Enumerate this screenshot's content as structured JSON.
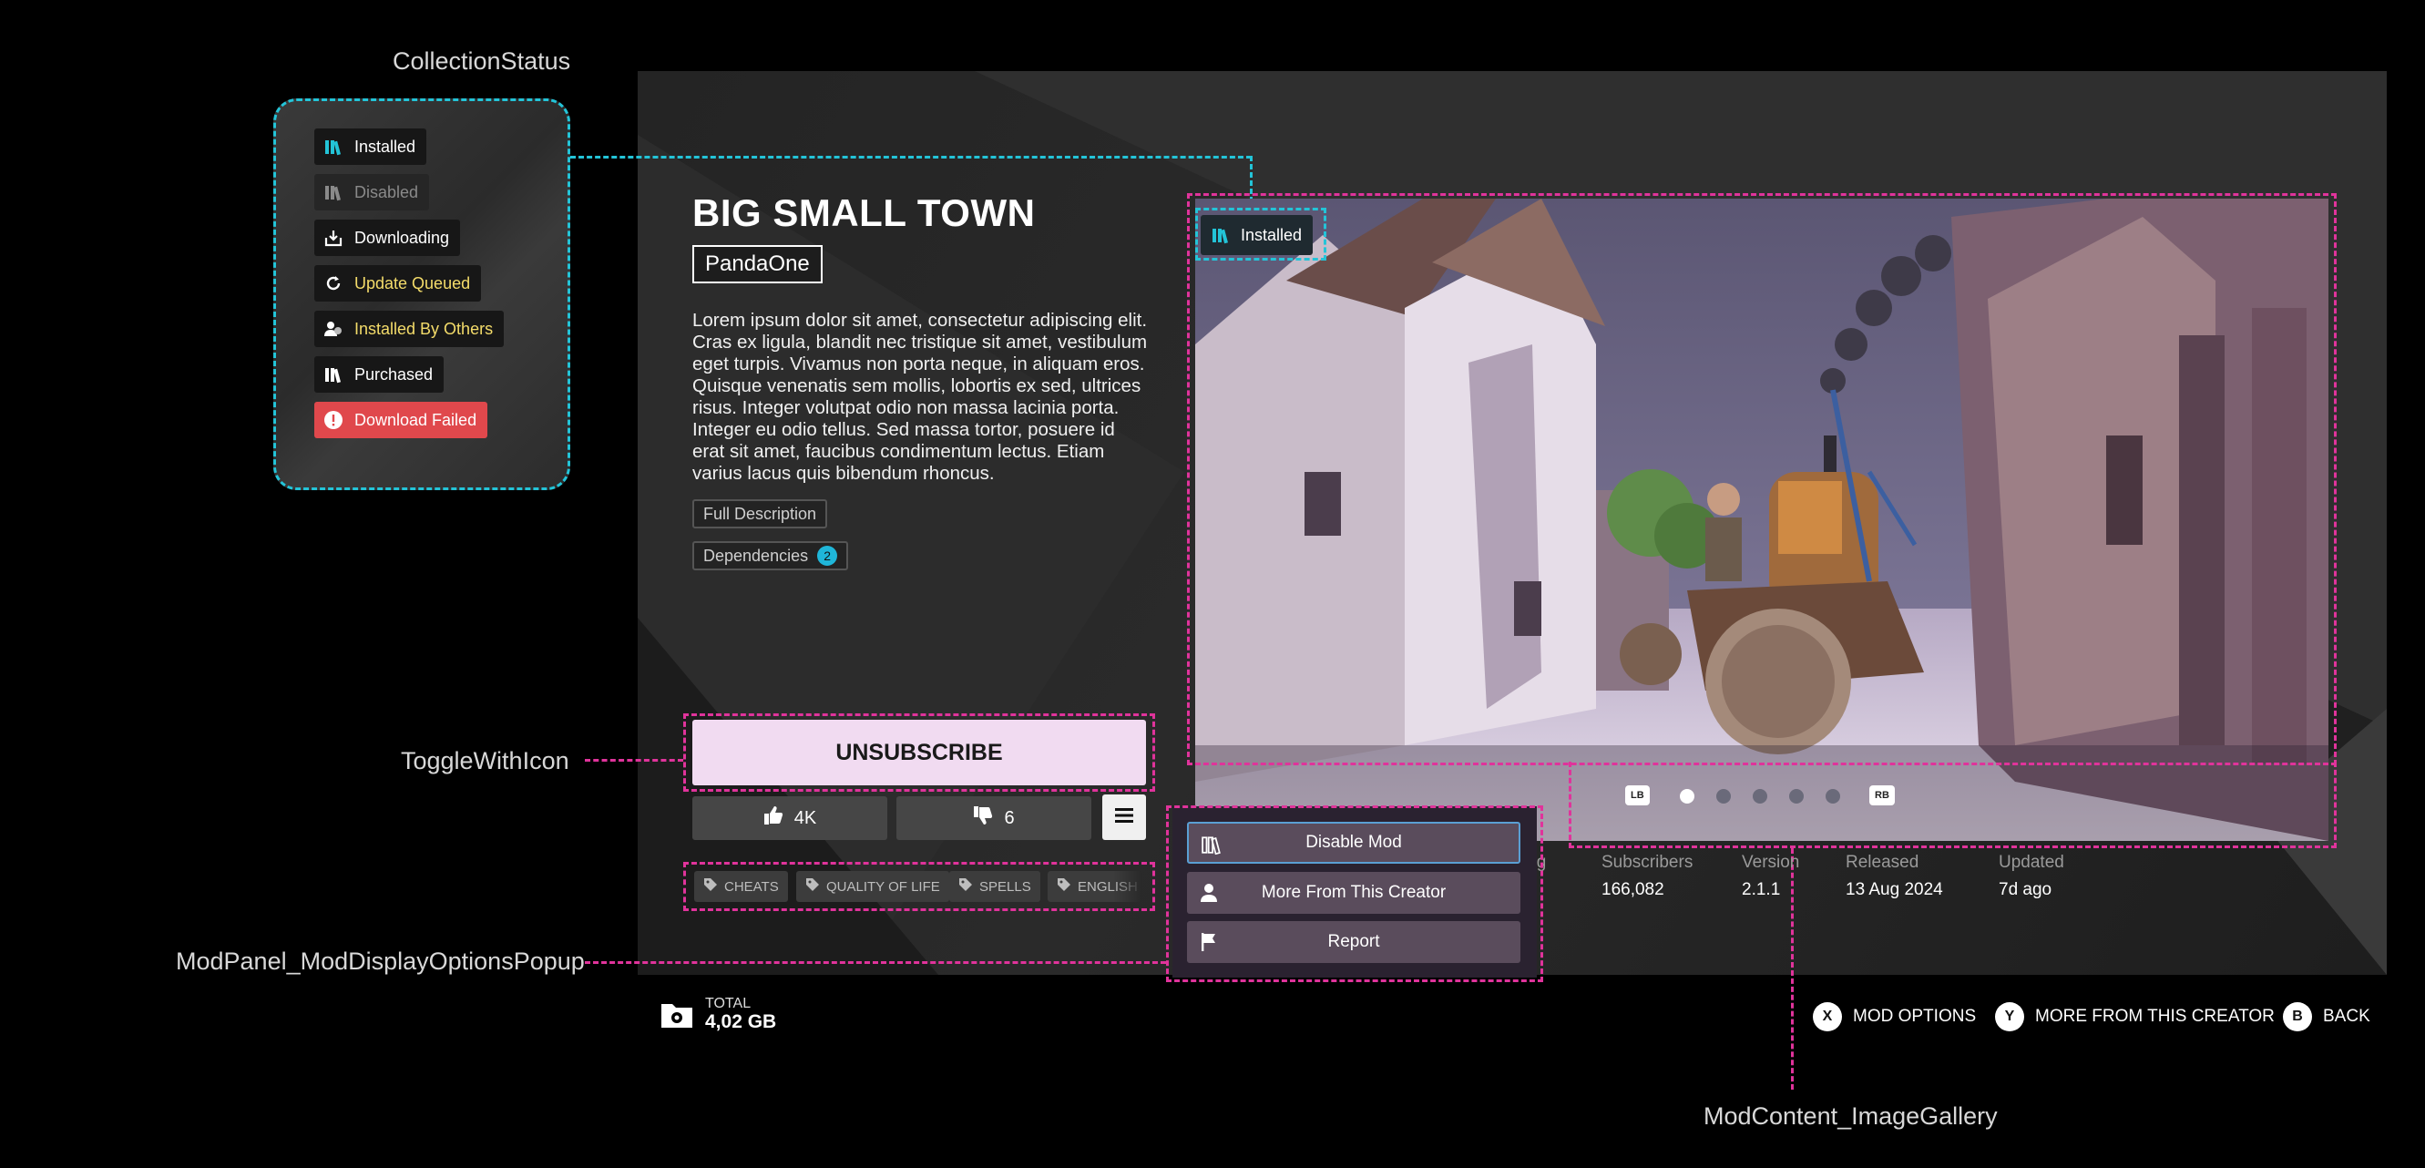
{
  "annotations": {
    "collection_status": "CollectionStatus",
    "toggle_with_icon": "ToggleWithIcon",
    "options_popup": "ModPanel_ModDisplayOptionsPopup",
    "image_gallery": "ModContent_ImageGallery"
  },
  "status_chips": [
    {
      "label": "Installed",
      "icon": "library-icon",
      "color": "#23c4d8"
    },
    {
      "label": "Disabled",
      "icon": "library-icon",
      "color": "#8a8a8a"
    },
    {
      "label": "Downloading",
      "icon": "download-icon",
      "color": "#ffffff"
    },
    {
      "label": "Update Queued",
      "icon": "refresh-icon",
      "color": "#f4dc6a"
    },
    {
      "label": "Installed By Others",
      "icon": "users-icon",
      "color": "#f4dc6a"
    },
    {
      "label": "Purchased",
      "icon": "library-icon",
      "color": "#ffffff"
    },
    {
      "label": "Download Failed",
      "icon": "alert-icon",
      "color": "#e0484c"
    }
  ],
  "mod": {
    "title": "BIG SMALL TOWN",
    "author": "PandaOne",
    "description": "Lorem ipsum dolor sit amet, consectetur adipiscing elit. Cras ex ligula, blandit nec tristique sit amet, vestibulum eget turpis. Vivamus non porta neque, in aliquam eros. Quisque venenatis sem mollis, lobortis ex sed, ultrices risus. Integer volutpat odio non massa lacinia porta. Integer eu odio tellus. Sed massa tortor, posuere id erat sit amet, faucibus condimentum lectus. Etiam varius lacus quis bibendum rhoncus.",
    "full_description_label": "Full Description",
    "dependencies_label": "Dependencies",
    "dependencies_count": "2",
    "unsubscribe_label": "UNSUBSCRIBE",
    "likes": "4K",
    "dislikes": "6",
    "tags": [
      "CHEATS",
      "QUALITY OF LIFE",
      "SPELLS",
      "ENGLISH"
    ]
  },
  "gallery": {
    "status_label": "Installed",
    "lb": "LB",
    "rb": "RB",
    "image_count": 5,
    "active_index": 0
  },
  "stats": {
    "rating_partial": "ing",
    "subscribers_label": "Subscribers",
    "subscribers": "166,082",
    "version_label": "Version",
    "version": "2.1.1",
    "released_label": "Released",
    "released": "13 Aug 2024",
    "updated_label": "Updated",
    "updated": "7d ago"
  },
  "popup": {
    "disable_label": "Disable Mod",
    "creator_label": "More From This Creator",
    "report_label": "Report"
  },
  "footer": {
    "total_label": "TOTAL",
    "total_value": "4,02 GB",
    "hints": [
      {
        "key": "X",
        "label": "MOD OPTIONS"
      },
      {
        "key": "Y",
        "label": "MORE FROM THIS CREATOR"
      },
      {
        "key": "B",
        "label": "BACK"
      }
    ]
  },
  "colors": {
    "accent_cyan": "#23c4d8",
    "annotation_pink": "#e0339b",
    "warning_yellow": "#f4dc6a",
    "error_red": "#e0484c",
    "unsubscribe_bg": "#f1dbf1"
  }
}
